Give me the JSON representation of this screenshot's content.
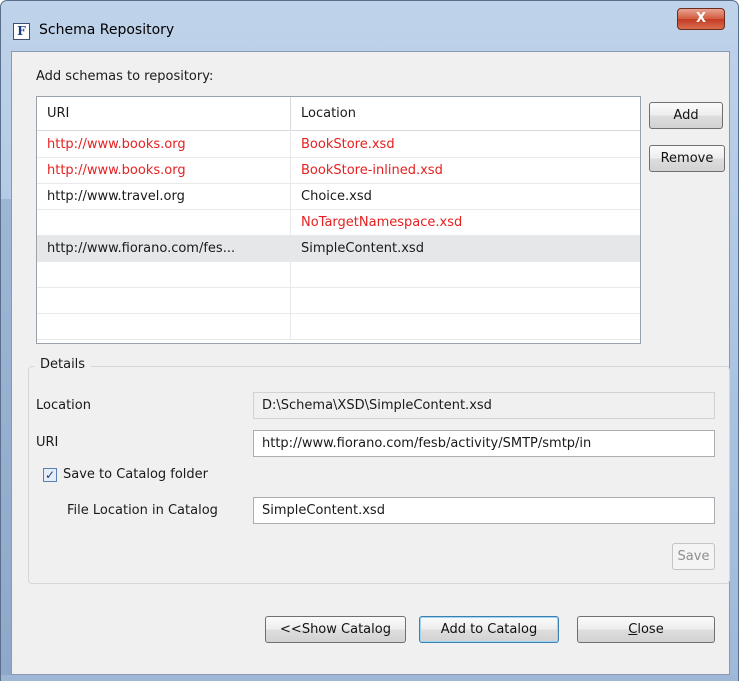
{
  "window": {
    "title": "Schema Repository",
    "app_icon_glyph": "F",
    "close_glyph": "X"
  },
  "schemas": {
    "label": "Add schemas to repository:",
    "columns": [
      "URI",
      "Location"
    ],
    "rows": [
      {
        "uri": "http://www.books.org",
        "location": "BookStore.xsd",
        "uri_color": "#e62020",
        "loc_color": "#e62020"
      },
      {
        "uri": "http://www.books.org",
        "location": "BookStore-inlined.xsd",
        "uri_color": "#e62020",
        "loc_color": "#e62020"
      },
      {
        "uri": "http://www.travel.org",
        "location": "Choice.xsd",
        "uri_color": "#1a1a1a",
        "loc_color": "#1a1a1a"
      },
      {
        "uri": "",
        "location": "NoTargetNamespace.xsd",
        "uri_color": "#1a1a1a",
        "loc_color": "#e62020"
      },
      {
        "uri": "http://www.fiorano.com/fes...",
        "location": "SimpleContent.xsd",
        "uri_color": "#1a1a1a",
        "loc_color": "#1a1a1a",
        "selected": true
      }
    ],
    "add_button": "Add",
    "remove_button": "Remove"
  },
  "details": {
    "legend": "Details",
    "location_label": "Location",
    "location_value": "D:\\Schema\\XSD\\SimpleContent.xsd",
    "uri_label": "URI",
    "uri_value": "http://www.fiorano.com/fesb/activity/SMTP/smtp/in",
    "save_checkbox_label": "Save to Catalog folder",
    "save_checkbox_checked": true,
    "file_location_label": "File Location in Catalog",
    "file_location_value": "SimpleContent.xsd",
    "save_button": "Save"
  },
  "footer": {
    "show_catalog_button": "<<Show Catalog",
    "add_to_catalog_button": "Add to Catalog",
    "close_button_prefix": "C",
    "close_button_rest": "lose"
  },
  "colors": {
    "error_red": "#e62020",
    "selection_bg": "#e6e7e9",
    "dialog_bg": "#f0f0f0"
  }
}
